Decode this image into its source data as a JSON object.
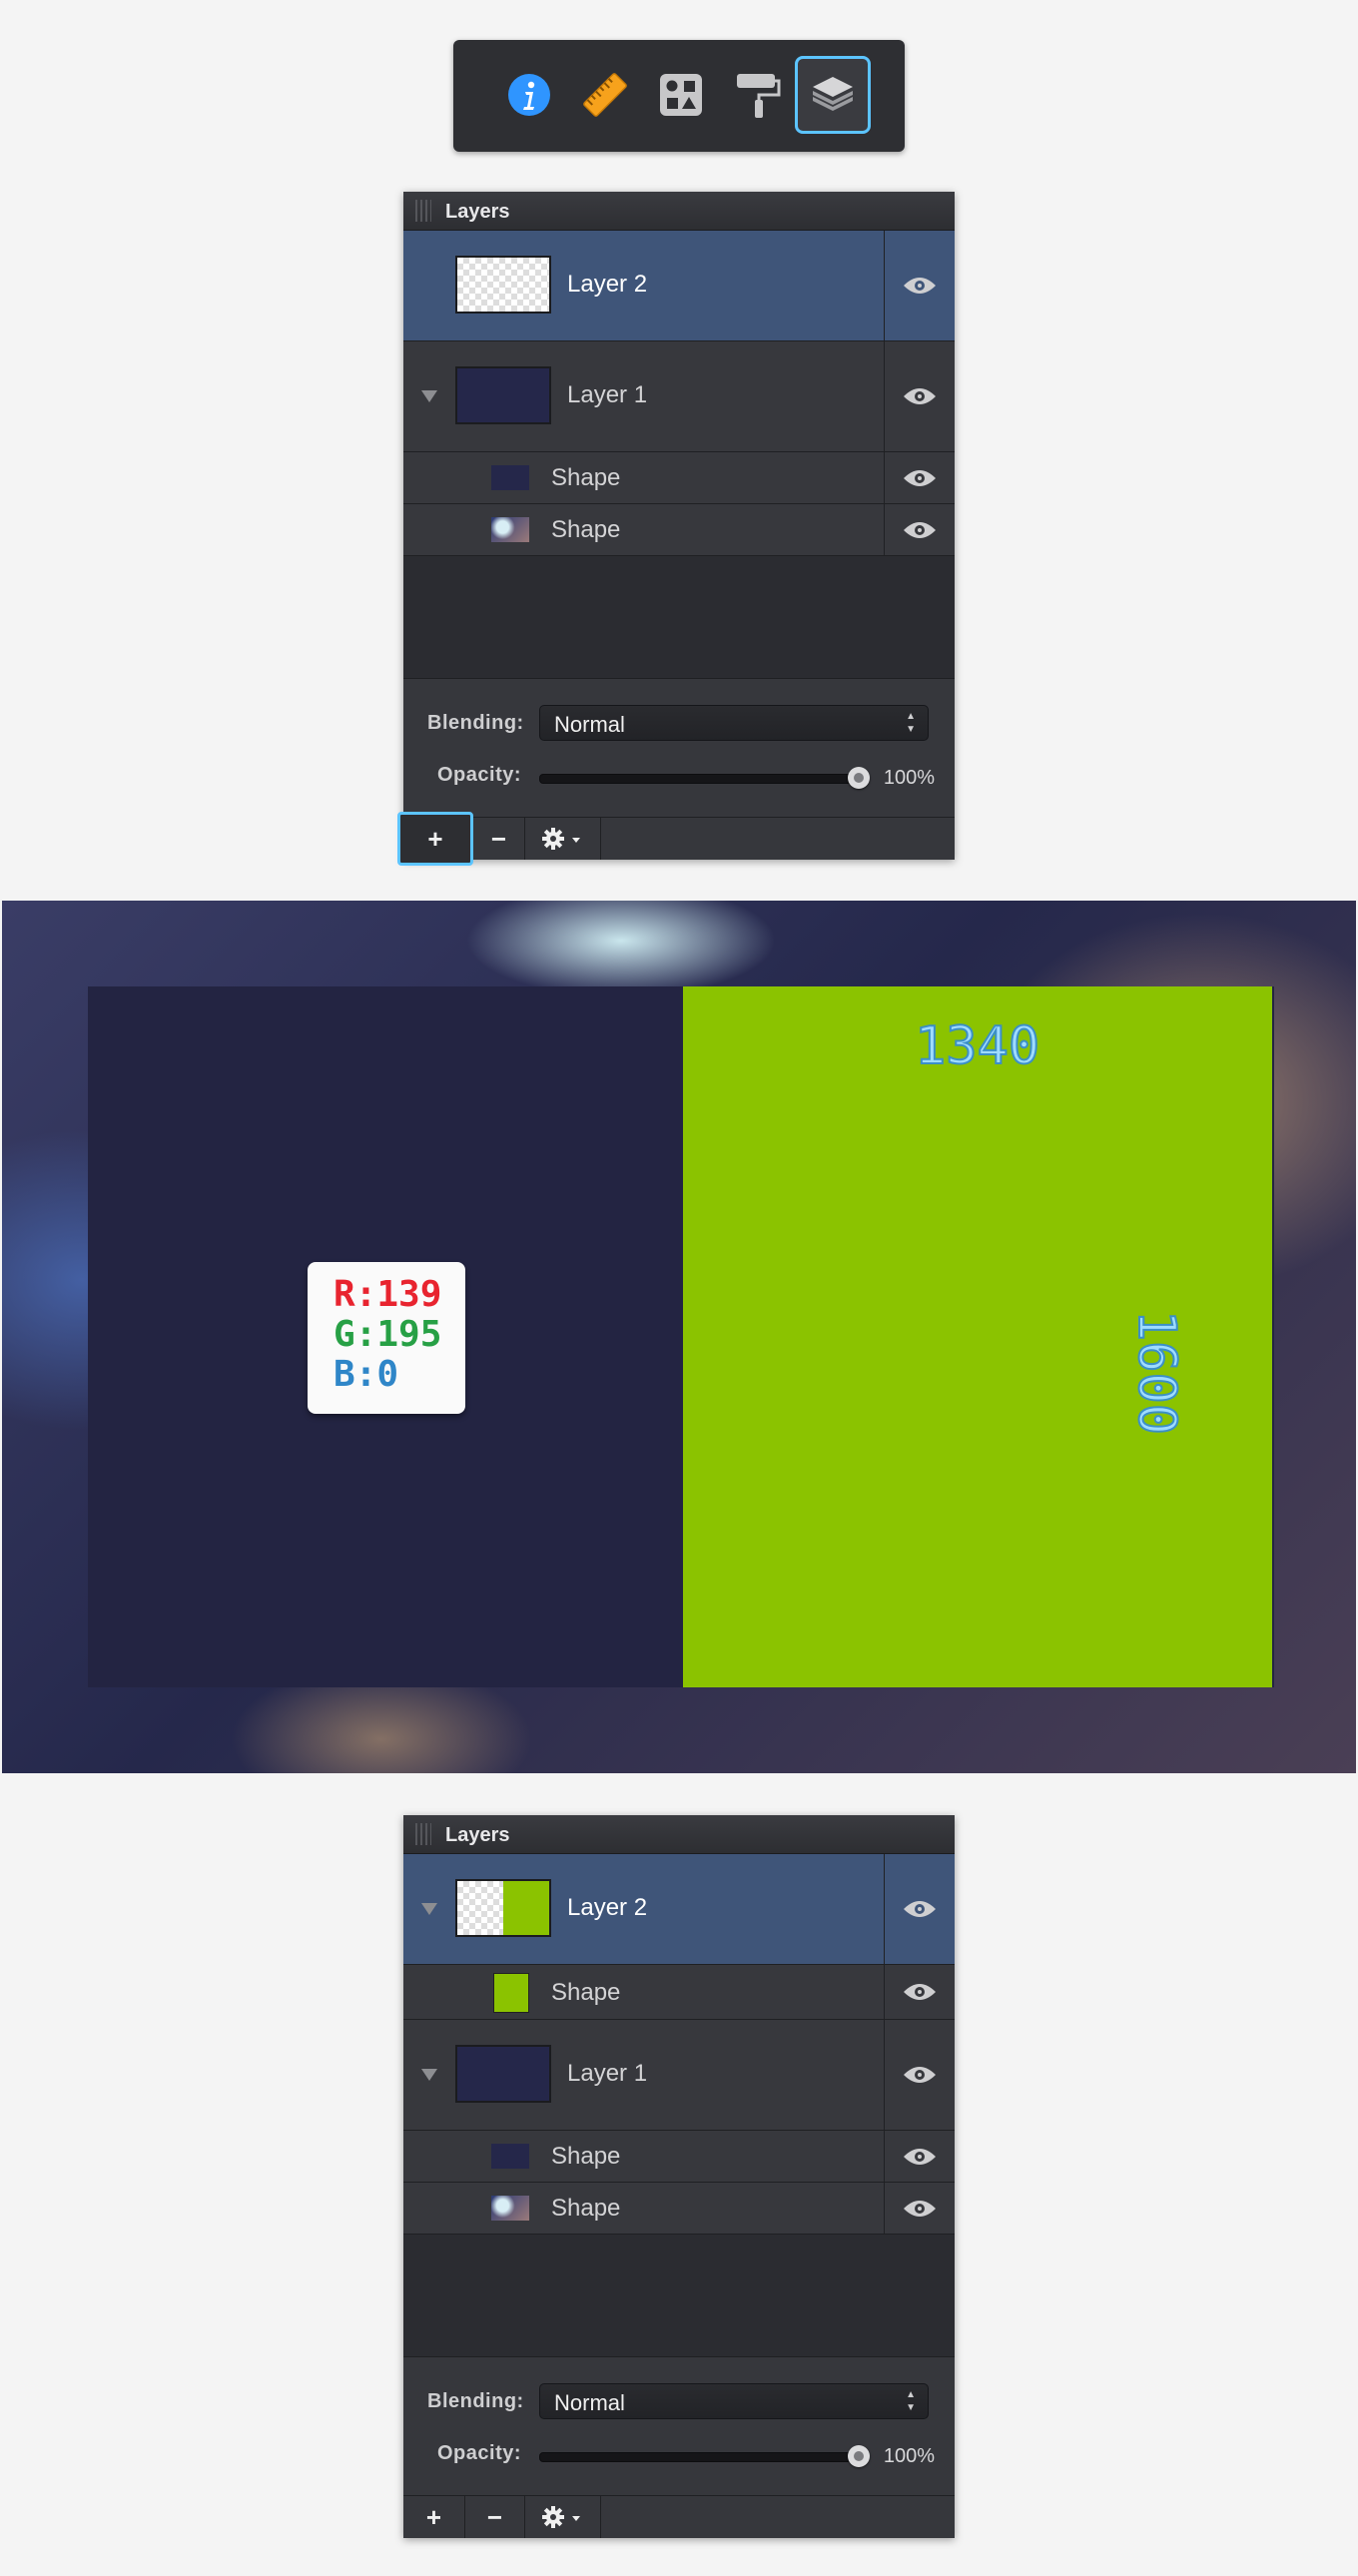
{
  "toolbar": {
    "tools": [
      {
        "icon": "info-icon",
        "selected": false
      },
      {
        "icon": "ruler-icon",
        "selected": false
      },
      {
        "icon": "shapes-icon",
        "selected": false
      },
      {
        "icon": "paint-roller-icon",
        "selected": false
      },
      {
        "icon": "layers-icon",
        "selected": true
      }
    ]
  },
  "panel_top": {
    "title": "Layers",
    "rows": [
      {
        "label": "Layer 2"
      },
      {
        "label": "Layer 1"
      },
      {
        "label": "Shape"
      },
      {
        "label": "Shape"
      }
    ],
    "blending_label": "Blending:",
    "blending_value": "Normal",
    "opacity_label": "Opacity:",
    "opacity_value": "100%",
    "opacity_fraction": 1.0
  },
  "canvas": {
    "width_label": "1340",
    "height_label": "1600",
    "color": {
      "r": "R:139",
      "g": "G:195",
      "b": "B:0"
    },
    "fill_color": "#8bc300"
  },
  "panel_bottom": {
    "title": "Layers",
    "rows": [
      {
        "label": "Layer 2"
      },
      {
        "label": "Shape"
      },
      {
        "label": "Layer 1"
      },
      {
        "label": "Shape"
      },
      {
        "label": "Shape"
      }
    ],
    "blending_label": "Blending:",
    "blending_value": "Normal",
    "opacity_label": "Opacity:",
    "opacity_value": "100%",
    "opacity_fraction": 1.0
  },
  "buttons": {
    "add": "+",
    "remove": "−"
  },
  "colors": {
    "selection": "#5cc4ff",
    "selected_row": "#3f5579",
    "navy": "#232442"
  }
}
